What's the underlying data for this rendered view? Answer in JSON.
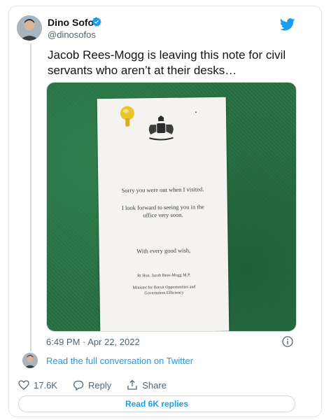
{
  "author": {
    "name": "Dino Sofos",
    "handle": "@dinosofos"
  },
  "tweet": {
    "text": "Jacob Rees-Mogg is leaving this note for civil servants who aren’t at their desks…"
  },
  "note": {
    "line1": "Sorry you were out when I visited.",
    "line2": "I look forward to seeing you in the office very soon.",
    "line3": "With every good wish,",
    "signature": "Rt Hon. Jacob Rees-Mogg M.P.",
    "role": "Minister for Brexit Opportunities and Government Efficiency"
  },
  "meta": {
    "timestamp": "6:49 PM · Apr 22, 2022",
    "conversation_link": "Read the full conversation on Twitter"
  },
  "actions": {
    "likes": "17.6K",
    "reply_label": "Reply",
    "share_label": "Share",
    "read_replies": "Read 6K replies"
  },
  "colors": {
    "accent": "#1d9bf0",
    "verified": "#1d9bf0",
    "text_secondary": "#536471"
  },
  "icons": [
    "twitter-bird-icon",
    "verified-badge-icon",
    "info-icon",
    "heart-icon",
    "reply-icon",
    "share-icon"
  ]
}
